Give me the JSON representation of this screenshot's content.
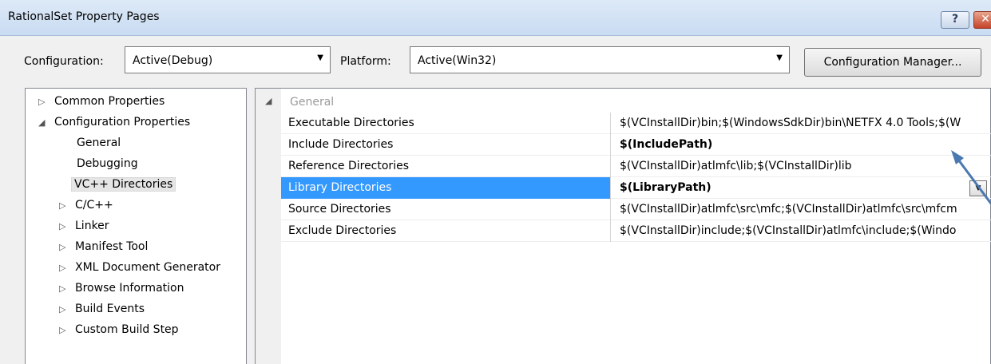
{
  "window": {
    "title": "RationalSet Property Pages",
    "help_label": "?",
    "close_label": "✕"
  },
  "config": {
    "configuration_label": "Configuration:",
    "configuration_value": "Active(Debug)",
    "platform_label": "Platform:",
    "platform_value": "Active(Win32)",
    "manager_button": "Configuration Manager..."
  },
  "tree": {
    "items": [
      {
        "label": "Common Properties",
        "glyph": "▷"
      },
      {
        "label": "Configuration Properties",
        "glyph": "◢"
      },
      {
        "label": "General",
        "glyph": ""
      },
      {
        "label": "Debugging",
        "glyph": ""
      },
      {
        "label": "VC++ Directories",
        "glyph": "",
        "selected": true
      },
      {
        "label": "C/C++",
        "glyph": "▷"
      },
      {
        "label": "Linker",
        "glyph": "▷"
      },
      {
        "label": "Manifest Tool",
        "glyph": "▷"
      },
      {
        "label": "XML Document Generator",
        "glyph": "▷"
      },
      {
        "label": "Browse Information",
        "glyph": "▷"
      },
      {
        "label": "Build Events",
        "glyph": "▷"
      },
      {
        "label": "Custom Build Step",
        "glyph": "▷"
      }
    ]
  },
  "grid": {
    "section_label": "General",
    "rows": [
      {
        "name": "Executable Directories",
        "value": "$(VCInstallDir)bin;$(WindowsSdkDir)bin\\NETFX 4.0 Tools;$(W"
      },
      {
        "name": "Include Directories",
        "value": "$(IncludePath)"
      },
      {
        "name": "Reference Directories",
        "value": "$(VCInstallDir)atlmfc\\lib;$(VCInstallDir)lib"
      },
      {
        "name": "Library Directories",
        "value": "$(LibraryPath)"
      },
      {
        "name": "Source Directories",
        "value": "$(VCInstallDir)atlmfc\\src\\mfc;$(VCInstallDir)atlmfc\\src\\mfcm"
      },
      {
        "name": "Exclude Directories",
        "value": "$(VCInstallDir)include;$(VCInstallDir)atlmfc\\include;$(Windo"
      }
    ]
  },
  "colors": {
    "selection": "#3399ff",
    "arrow": "#4a78b0"
  }
}
